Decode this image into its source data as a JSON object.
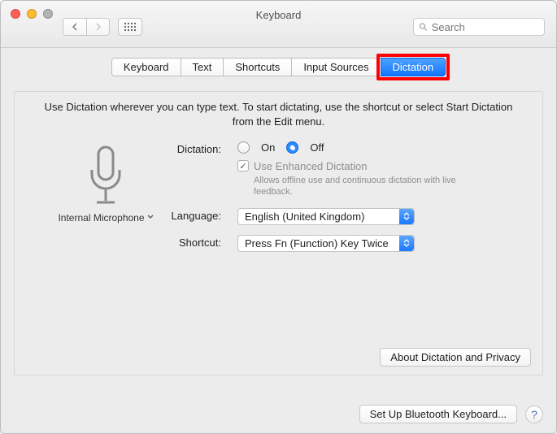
{
  "window": {
    "title": "Keyboard",
    "search_placeholder": "Search"
  },
  "tabs": [
    "Keyboard",
    "Text",
    "Shortcuts",
    "Input Sources",
    "Dictation"
  ],
  "selected_tab": "Dictation",
  "description": "Use Dictation wherever you can type text. To start dictating, use the shortcut or select Start Dictation from the Edit menu.",
  "mic": {
    "label": "Internal Microphone"
  },
  "dictation": {
    "label": "Dictation:",
    "on_label": "On",
    "off_label": "Off",
    "value": "Off",
    "enhanced_label": "Use Enhanced Dictation",
    "enhanced_checked": true,
    "enhanced_sub": "Allows offline use and continuous dictation with live feedback."
  },
  "language": {
    "label": "Language:",
    "value": "English (United Kingdom)"
  },
  "shortcut": {
    "label": "Shortcut:",
    "value": "Press Fn (Function) Key Twice"
  },
  "about_button": "About Dictation and Privacy",
  "bluetooth_button": "Set Up Bluetooth Keyboard..."
}
